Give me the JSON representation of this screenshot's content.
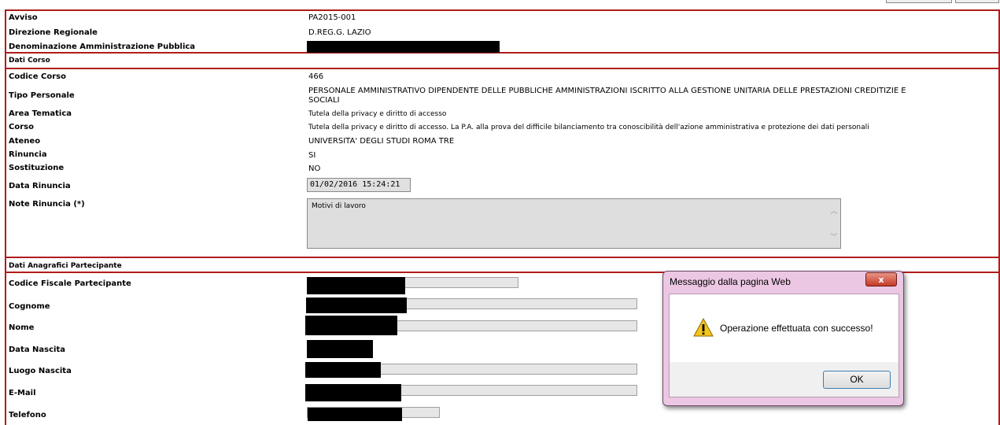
{
  "top_fragment": "",
  "info": {
    "rows": [
      {
        "label": "Avviso",
        "value": "PA2015-001"
      },
      {
        "label": "Direzione Regionale",
        "value": "D.REG.G. LAZIO"
      },
      {
        "label": "Denominazione Amministrazione Pubblica",
        "value": ""
      }
    ]
  },
  "dati_corso": {
    "header": "Dati Corso",
    "codice_label": "Codice Corso",
    "codice_value": "466",
    "tipo_label": "Tipo Personale",
    "tipo_value_1": "PERSONALE AMMINISTRATIVO DIPENDENTE DELLE PUBBLICHE AMMINISTRAZIONI ISCRITTO ALLA GESTIONE UNITARIA DELLE PRESTAZIONI CREDITIZIE E",
    "tipo_value_2": "SOCIALI",
    "area_label": "Area Tematica",
    "area_value": "Tutela della privacy e diritto di accesso",
    "corso_label": "Corso",
    "corso_value": "Tutela della privacy e diritto di accesso. La P.A. alla prova del difficile bilanciamento tra conoscibilità dell'azione amministrativa e protezione dei dati personali",
    "ateneo_label": "Ateneo",
    "ateneo_value": "UNIVERSITA' DEGLI STUDI ROMA TRE",
    "rinuncia_label": "Rinuncia",
    "rinuncia_value": "SI",
    "sostituzione_label": "Sostituzione",
    "sostituzione_value": "NO",
    "data_rinuncia_label": "Data Rinuncia",
    "data_rinuncia_value": "01/02/2016 15:24:21",
    "note_label": "Note Rinuncia (*)",
    "note_value": "Motivi di lavoro"
  },
  "partecipante": {
    "header": "Dati Anagrafici Partecipante",
    "fields": [
      {
        "label": "Codice Fiscale Partecipante"
      },
      {
        "label": "Cognome"
      },
      {
        "label": "Nome"
      },
      {
        "label": "Data Nascita"
      },
      {
        "label": "Luogo Nascita"
      },
      {
        "label": "E-Mail"
      },
      {
        "label": "Telefono"
      }
    ]
  },
  "dialog": {
    "title": "Messaggio dalla pagina Web",
    "close": "x",
    "message": "Operazione effettuata con successo!",
    "ok": "OK",
    "icon": "warning-icon"
  },
  "colors": {
    "section_border": "#b01c1c",
    "field_bg": "#e6e6e6",
    "dialog_frame": "#ecc7e4"
  }
}
